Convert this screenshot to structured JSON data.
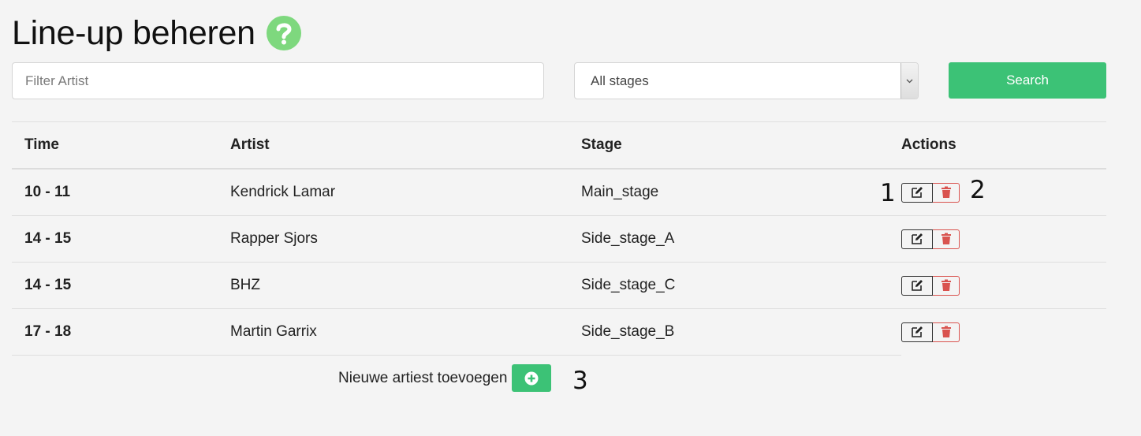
{
  "header": {
    "title": "Line-up beheren",
    "help_icon": "question-circle-icon"
  },
  "filters": {
    "artist_placeholder": "Filter Artist",
    "artist_value": "",
    "stage_selected": "All stages",
    "search_label": "Search"
  },
  "table": {
    "columns": [
      "Time",
      "Artist",
      "Stage",
      "Actions"
    ],
    "rows": [
      {
        "time": "10 - 11",
        "artist": "Kendrick Lamar",
        "stage": "Main_stage"
      },
      {
        "time": "14 - 15",
        "artist": "Rapper Sjors",
        "stage": "Side_stage_A"
      },
      {
        "time": "14 - 15",
        "artist": "BHZ",
        "stage": "Side_stage_C"
      },
      {
        "time": "17 - 18",
        "artist": "Martin Garrix",
        "stage": "Side_stage_B"
      }
    ],
    "edit_icon": "edit-icon",
    "delete_icon": "trash-icon"
  },
  "add_artist": {
    "label": "Nieuwe artiest toevoegen",
    "icon": "plus-circle-icon"
  },
  "callouts": [
    "1",
    "2",
    "3"
  ],
  "colors": {
    "accent_green": "#3cc276",
    "help_green": "#7ed87e",
    "delete_red": "#d9534f",
    "background": "#f4f4f4"
  }
}
